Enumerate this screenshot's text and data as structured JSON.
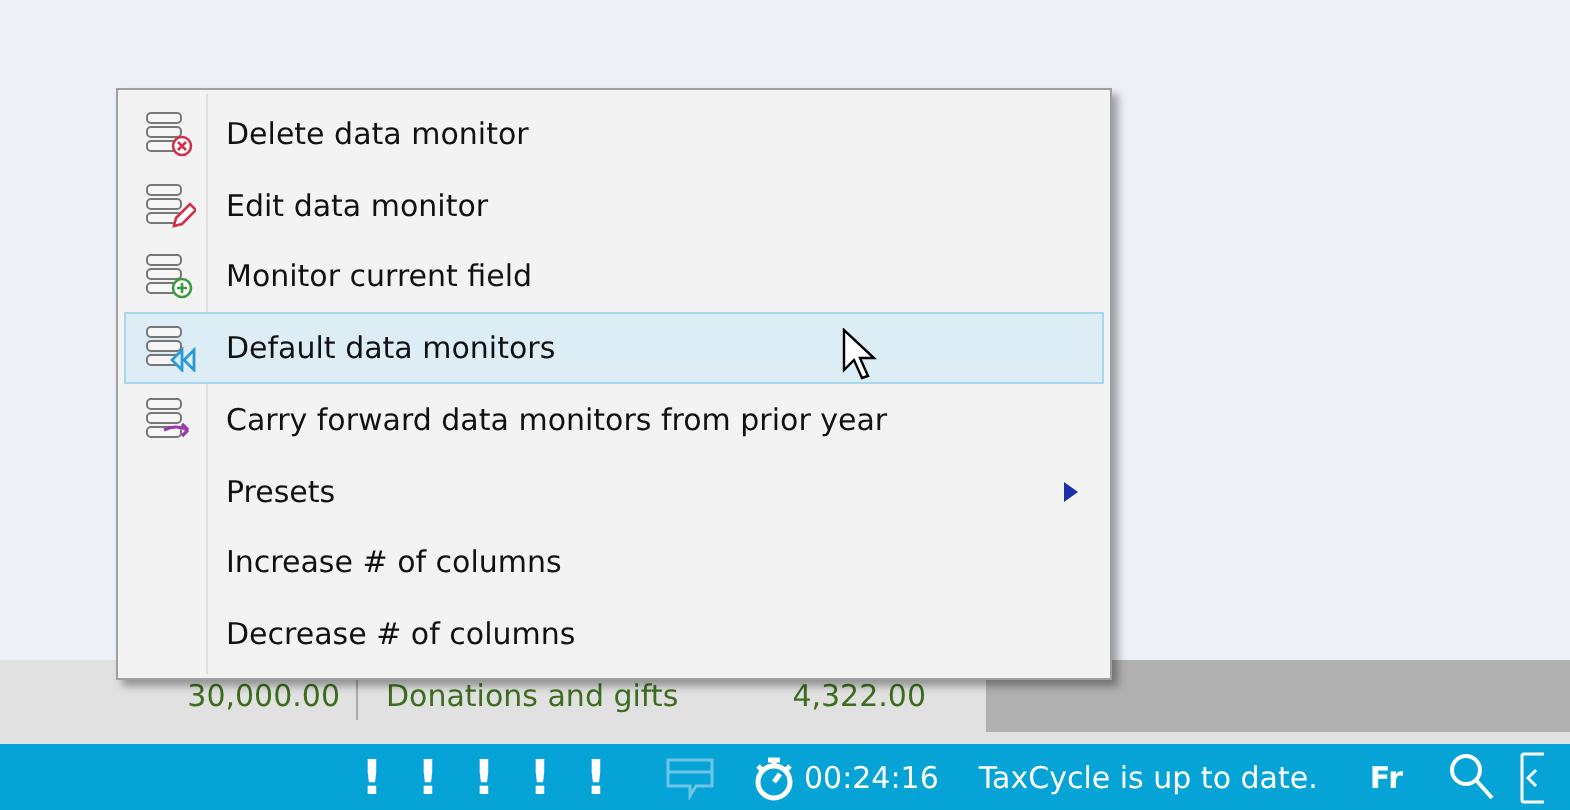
{
  "menu": {
    "items": [
      {
        "label": "Delete data monitor",
        "kind": "delete",
        "selected": false,
        "submenu": false
      },
      {
        "label": "Edit data monitor",
        "kind": "edit",
        "selected": false,
        "submenu": false
      },
      {
        "label": "Monitor current field",
        "kind": "add",
        "selected": false,
        "submenu": false
      },
      {
        "label": "Default data monitors",
        "kind": "default",
        "selected": true,
        "submenu": false
      },
      {
        "label": "Carry forward data monitors from prior year",
        "kind": "carry",
        "selected": false,
        "submenu": false
      },
      {
        "label": "Presets",
        "kind": "plain",
        "selected": false,
        "submenu": true
      },
      {
        "label": "Increase # of columns",
        "kind": "plain",
        "selected": false,
        "submenu": false
      },
      {
        "label": "Decrease # of columns",
        "kind": "plain",
        "selected": false,
        "submenu": false
      }
    ]
  },
  "row": {
    "cells": [
      "30,000.00",
      "Donations and gifts",
      "4,322.00"
    ]
  },
  "status_bar": {
    "warnings": [
      "!",
      "!",
      "!",
      "!",
      "!"
    ],
    "timer": "00:24:16",
    "message": "TaxCycle is up to date.",
    "language": "Fr"
  }
}
